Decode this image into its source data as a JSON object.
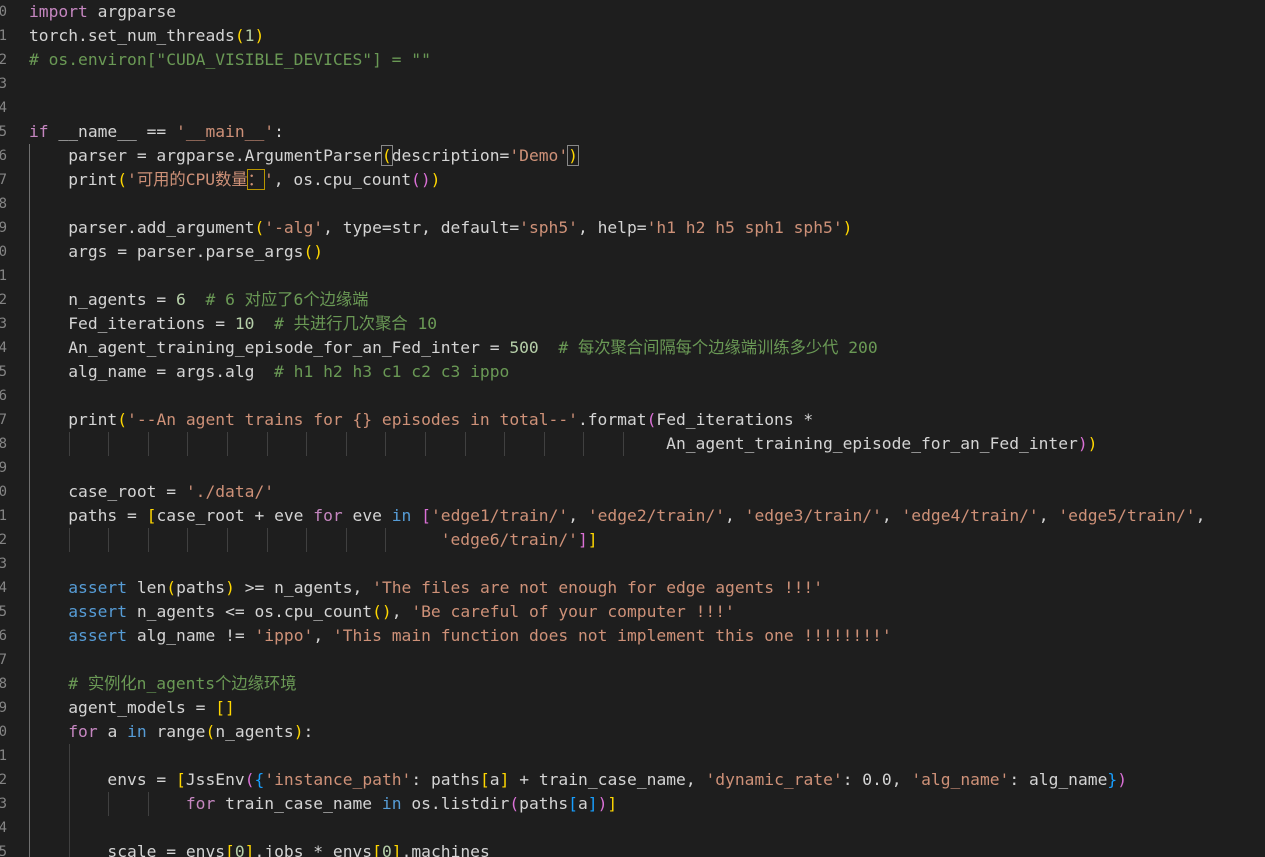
{
  "editor": {
    "visible_line_numbers": [
      "0",
      "1",
      "2",
      "3",
      "4",
      "5",
      "6",
      "7",
      "8",
      "9",
      "0",
      "1",
      "2",
      "3",
      "4",
      "5",
      "6",
      "7",
      "8",
      "9",
      "0",
      "1",
      "2",
      "3",
      "4",
      "5",
      "6",
      "7",
      "8",
      "9",
      "0",
      "1",
      "2",
      "3",
      "4",
      "5"
    ],
    "lines": [
      [
        {
          "t": "import",
          "c": "fl"
        },
        {
          "t": " argparse"
        }
      ],
      [
        {
          "t": "torch.set_num_threads"
        },
        {
          "t": "(",
          "c": "b1"
        },
        {
          "t": "1",
          "c": "n"
        },
        {
          "t": ")",
          "c": "b1"
        }
      ],
      [
        {
          "t": "# os.environ[\"CUDA_VISIBLE_DEVICES\"] = \"\"",
          "c": "c"
        }
      ],
      [],
      [],
      [
        {
          "t": "if",
          "c": "fl"
        },
        {
          "t": " __name__ == "
        },
        {
          "t": "'__main__'",
          "c": "s"
        },
        {
          "t": ":"
        }
      ],
      [
        {
          "t": "    parser = argparse.ArgumentParser"
        },
        {
          "t": "(",
          "c": "b1 bm"
        },
        {
          "t": "description="
        },
        {
          "t": "'Demo'",
          "c": "s"
        },
        {
          "t": ")",
          "c": "b1 bm"
        }
      ],
      [
        {
          "t": "    print"
        },
        {
          "t": "(",
          "c": "b1"
        },
        {
          "t": "'可用的CPU数量",
          "c": "s"
        },
        {
          "t": "：",
          "c": "s ws"
        },
        {
          "t": "'",
          "c": "s"
        },
        {
          "t": ", os.cpu_count"
        },
        {
          "t": "()",
          "c": "b2"
        },
        {
          "t": ")",
          "c": "b1"
        }
      ],
      [],
      [
        {
          "t": "    parser.add_argument"
        },
        {
          "t": "(",
          "c": "b1"
        },
        {
          "t": "'-alg'",
          "c": "s"
        },
        {
          "t": ", type=str, default="
        },
        {
          "t": "'sph5'",
          "c": "s"
        },
        {
          "t": ", help="
        },
        {
          "t": "'h1 h2 h5 sph1 sph5'",
          "c": "s"
        },
        {
          "t": ")",
          "c": "b1"
        }
      ],
      [
        {
          "t": "    args = parser.parse_args"
        },
        {
          "t": "()",
          "c": "b1"
        }
      ],
      [],
      [
        {
          "t": "    n_agents = "
        },
        {
          "t": "6",
          "c": "n"
        },
        {
          "t": "  # 6 对应了6个边缘端",
          "c": "c"
        }
      ],
      [
        {
          "t": "    Fed_iterations = "
        },
        {
          "t": "10",
          "c": "n"
        },
        {
          "t": "  # 共进行几次聚合 10",
          "c": "c"
        }
      ],
      [
        {
          "t": "    An_agent_training_episode_for_an_Fed_inter = "
        },
        {
          "t": "500",
          "c": "n"
        },
        {
          "t": "  # 每次聚合间隔每个边缘端训练多少代 200",
          "c": "c"
        }
      ],
      [
        {
          "t": "    alg_name = args.alg"
        },
        {
          "t": "  # h1 h2 h3 c1 c2 c3 ippo",
          "c": "c"
        }
      ],
      [],
      [
        {
          "t": "    print"
        },
        {
          "t": "(",
          "c": "b1"
        },
        {
          "t": "'--An agent trains for {} episodes in total--'",
          "c": "s"
        },
        {
          "t": ".format"
        },
        {
          "t": "(",
          "c": "b2"
        },
        {
          "t": "Fed_iterations *"
        }
      ],
      [
        {
          "t": "                                                                 An_agent_training_episode_for_an_Fed_inter"
        },
        {
          "t": ")",
          "c": "b2"
        },
        {
          "t": ")",
          "c": "b1"
        }
      ],
      [],
      [
        {
          "t": "    case_root = "
        },
        {
          "t": "'./data/'",
          "c": "s"
        }
      ],
      [
        {
          "t": "    paths = "
        },
        {
          "t": "[",
          "c": "b1"
        },
        {
          "t": "case_root + eve "
        },
        {
          "t": "for",
          "c": "fl"
        },
        {
          "t": " eve "
        },
        {
          "t": "in",
          "c": "kw"
        },
        {
          "t": " "
        },
        {
          "t": "[",
          "c": "b2"
        },
        {
          "t": "'edge1/train/'",
          "c": "s"
        },
        {
          "t": ", "
        },
        {
          "t": "'edge2/train/'",
          "c": "s"
        },
        {
          "t": ", "
        },
        {
          "t": "'edge3/train/'",
          "c": "s"
        },
        {
          "t": ", "
        },
        {
          "t": "'edge4/train/'",
          "c": "s"
        },
        {
          "t": ", "
        },
        {
          "t": "'edge5/train/'",
          "c": "s"
        },
        {
          "t": ","
        }
      ],
      [
        {
          "t": "                                          "
        },
        {
          "t": "'edge6/train/'",
          "c": "s"
        },
        {
          "t": "]",
          "c": "b2"
        },
        {
          "t": "]",
          "c": "b1"
        }
      ],
      [],
      [
        {
          "t": "    "
        },
        {
          "t": "assert",
          "c": "kw"
        },
        {
          "t": " len"
        },
        {
          "t": "(",
          "c": "b1"
        },
        {
          "t": "paths"
        },
        {
          "t": ")",
          "c": "b1"
        },
        {
          "t": " >= n_agents, "
        },
        {
          "t": "'The files are not enough for edge agents !!!'",
          "c": "s"
        }
      ],
      [
        {
          "t": "    "
        },
        {
          "t": "assert",
          "c": "kw"
        },
        {
          "t": " n_agents <= os.cpu_count"
        },
        {
          "t": "()",
          "c": "b1"
        },
        {
          "t": ", "
        },
        {
          "t": "'Be careful of your computer !!!'",
          "c": "s"
        }
      ],
      [
        {
          "t": "    "
        },
        {
          "t": "assert",
          "c": "kw"
        },
        {
          "t": " alg_name != "
        },
        {
          "t": "'ippo'",
          "c": "s"
        },
        {
          "t": ", "
        },
        {
          "t": "'This main function does not implement this one !!!!!!!!'",
          "c": "s"
        }
      ],
      [],
      [
        {
          "t": "    # 实例化n_agents个边缘环境",
          "c": "c"
        }
      ],
      [
        {
          "t": "    agent_models = "
        },
        {
          "t": "[]",
          "c": "b1"
        }
      ],
      [
        {
          "t": "    "
        },
        {
          "t": "for",
          "c": "fl"
        },
        {
          "t": " a "
        },
        {
          "t": "in",
          "c": "kw"
        },
        {
          "t": " range"
        },
        {
          "t": "(",
          "c": "b1"
        },
        {
          "t": "n_agents"
        },
        {
          "t": ")",
          "c": "b1"
        },
        {
          "t": ":"
        }
      ],
      [],
      [
        {
          "t": "        envs = "
        },
        {
          "t": "[",
          "c": "b1"
        },
        {
          "t": "JssEnv"
        },
        {
          "t": "(",
          "c": "b2"
        },
        {
          "t": "{",
          "c": "b3"
        },
        {
          "t": "'instance_path'",
          "c": "s"
        },
        {
          "t": ": paths"
        },
        {
          "t": "[",
          "c": "b1"
        },
        {
          "t": "a"
        },
        {
          "t": "]",
          "c": "b1"
        },
        {
          "t": " + train_case_name, "
        },
        {
          "t": "'dynamic_rate'",
          "c": "s"
        },
        {
          "t": ": 0.0, "
        },
        {
          "t": "'alg_name'",
          "c": "s"
        },
        {
          "t": ": alg_name"
        },
        {
          "t": "}",
          "c": "b3"
        },
        {
          "t": ")",
          "c": "b2"
        }
      ],
      [
        {
          "t": "                "
        },
        {
          "t": "for",
          "c": "fl"
        },
        {
          "t": " train_case_name "
        },
        {
          "t": "in",
          "c": "kw"
        },
        {
          "t": " os.listdir"
        },
        {
          "t": "(",
          "c": "b2"
        },
        {
          "t": "paths"
        },
        {
          "t": "[",
          "c": "b3"
        },
        {
          "t": "a"
        },
        {
          "t": "]",
          "c": "b3"
        },
        {
          "t": ")",
          "c": "b2"
        },
        {
          "t": "]",
          "c": "b1"
        }
      ],
      [],
      [
        {
          "t": "        scale = envs"
        },
        {
          "t": "[",
          "c": "b1"
        },
        {
          "t": "0",
          "c": "n"
        },
        {
          "t": "]",
          "c": "b1"
        },
        {
          "t": ".jobs * envs"
        },
        {
          "t": "[",
          "c": "b1"
        },
        {
          "t": "0",
          "c": "n"
        },
        {
          "t": "]",
          "c": "b1"
        },
        {
          "t": ".machines"
        }
      ]
    ]
  }
}
